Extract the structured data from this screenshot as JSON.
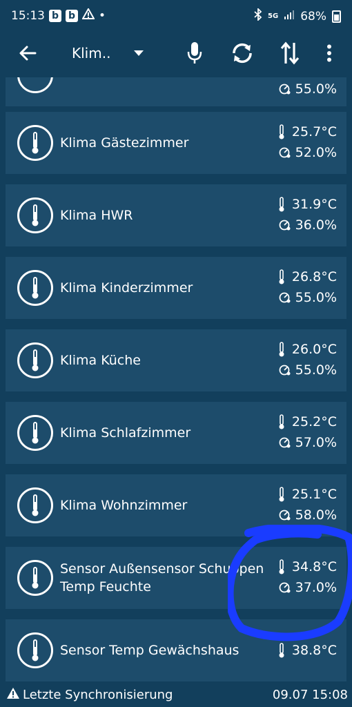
{
  "status_bar": {
    "time": "15:13",
    "notif_1": "b",
    "notif_2": "b",
    "notif_dot": "•",
    "network": "5G",
    "battery": "68%"
  },
  "toolbar": {
    "title": "Klim.."
  },
  "partial_top": {
    "humidity": "55.0%"
  },
  "devices": [
    {
      "name": "Klima Gästezimmer",
      "temperature": "25.7°C",
      "humidity": "52.0%"
    },
    {
      "name": "Klima HWR",
      "temperature": "31.9°C",
      "humidity": "36.0%"
    },
    {
      "name": "Klima Kinderzimmer",
      "temperature": "26.8°C",
      "humidity": "55.0%"
    },
    {
      "name": "Klima Küche",
      "temperature": "26.0°C",
      "humidity": "55.0%"
    },
    {
      "name": "Klima Schlafzimmer",
      "temperature": "25.2°C",
      "humidity": "57.0%"
    },
    {
      "name": "Klima Wohnzimmer",
      "temperature": "25.1°C",
      "humidity": "58.0%"
    },
    {
      "name": "Sensor Außensensor Schuppen Temp Feuchte",
      "temperature": "34.8°C",
      "humidity": "37.0%"
    },
    {
      "name": "Sensor Temp Gewächshaus",
      "temperature": "38.8°C"
    }
  ],
  "footer": {
    "sync_label": "Letzte Synchronisierung",
    "sync_time": "09.07 15:08"
  },
  "colors": {
    "background": "#123f5c",
    "card": "#1d4c6b",
    "annotation": "#1a3cff"
  }
}
